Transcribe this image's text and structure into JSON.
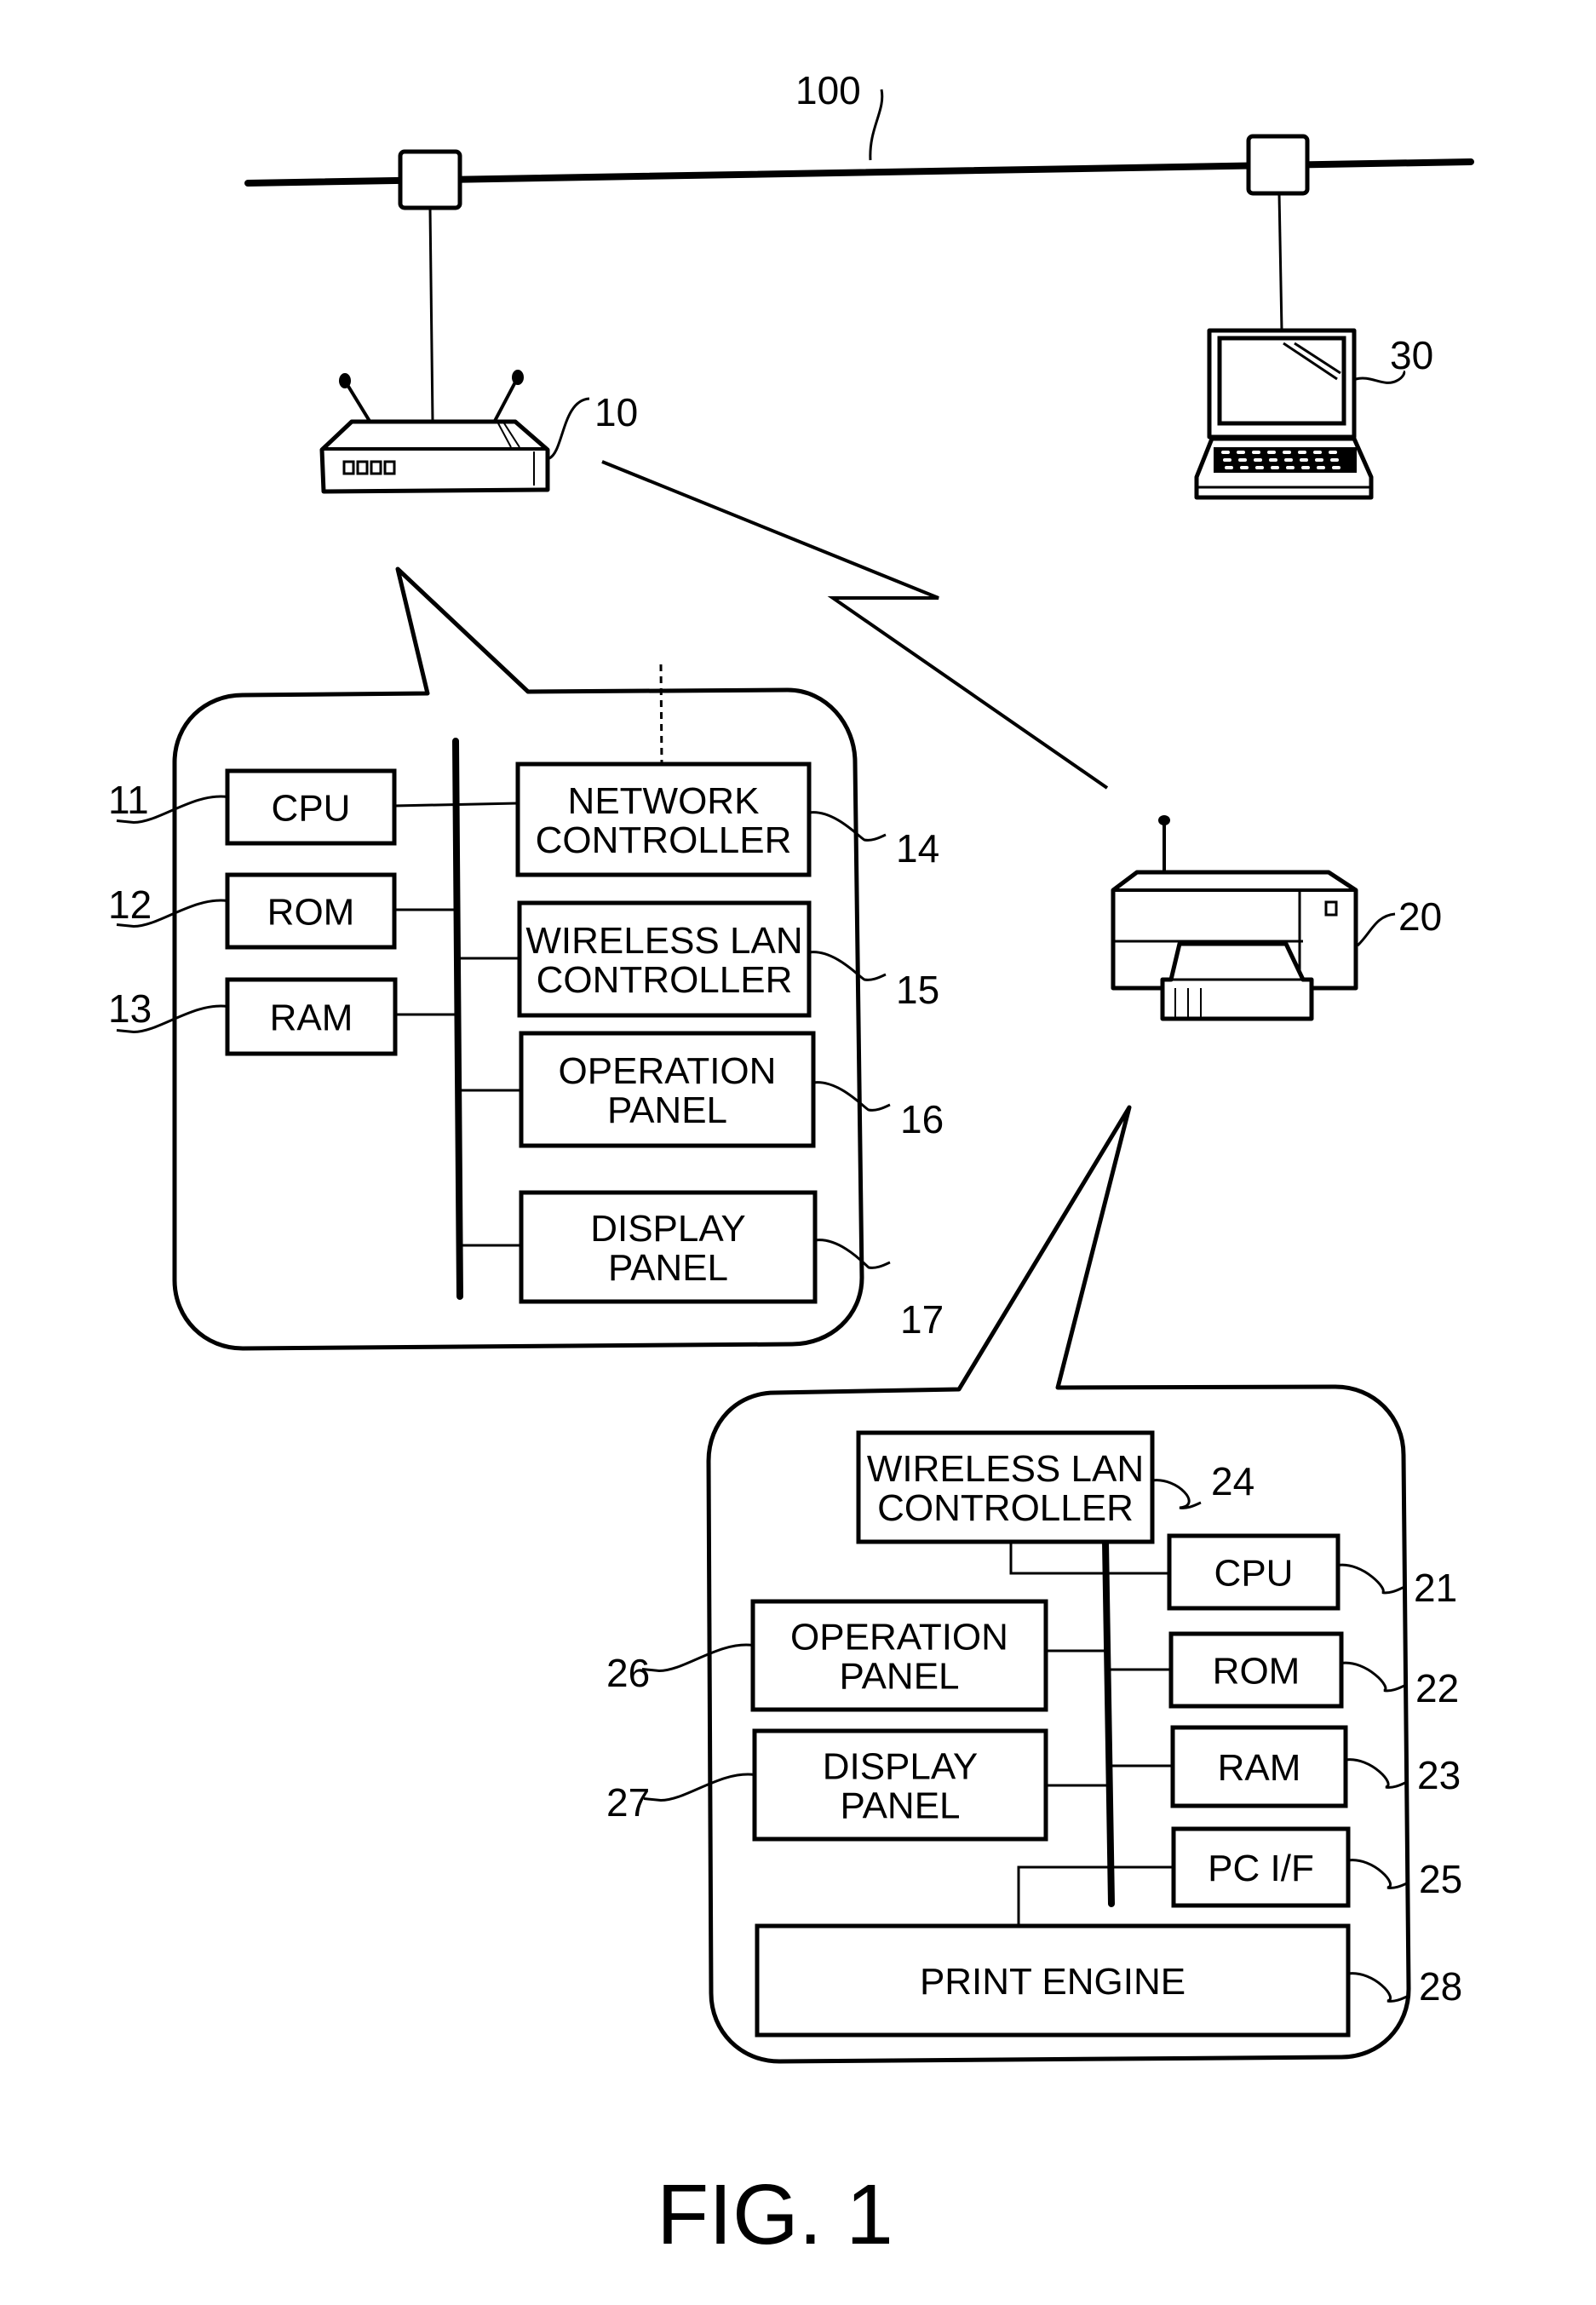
{
  "figure": {
    "caption": "FIG. 1",
    "network": {
      "ref": "100",
      "name": "network"
    },
    "devices": {
      "access_point": {
        "ref": "10",
        "name": "wireless access point"
      },
      "printer": {
        "ref": "20",
        "name": "printer"
      },
      "computer": {
        "ref": "30",
        "name": "personal computer"
      }
    },
    "access_point_blocks": [
      {
        "ref": "11",
        "lines": [
          "CPU"
        ]
      },
      {
        "ref": "12",
        "lines": [
          "ROM"
        ]
      },
      {
        "ref": "13",
        "lines": [
          "RAM"
        ]
      },
      {
        "ref": "14",
        "lines": [
          "NETWORK",
          "CONTROLLER"
        ]
      },
      {
        "ref": "15",
        "lines": [
          "WIRELESS LAN",
          "CONTROLLER"
        ]
      },
      {
        "ref": "16",
        "lines": [
          "OPERATION",
          "PANEL"
        ]
      },
      {
        "ref": "17",
        "lines": [
          "DISPLAY",
          "PANEL"
        ]
      }
    ],
    "printer_blocks": [
      {
        "ref": "21",
        "lines": [
          "CPU"
        ]
      },
      {
        "ref": "22",
        "lines": [
          "ROM"
        ]
      },
      {
        "ref": "23",
        "lines": [
          "RAM"
        ]
      },
      {
        "ref": "24",
        "lines": [
          "WIRELESS LAN",
          "CONTROLLER"
        ]
      },
      {
        "ref": "25",
        "lines": [
          "PC I/F"
        ]
      },
      {
        "ref": "26",
        "lines": [
          "OPERATION",
          "PANEL"
        ]
      },
      {
        "ref": "27",
        "lines": [
          "DISPLAY",
          "PANEL"
        ]
      },
      {
        "ref": "28",
        "lines": [
          "PRINT ENGINE"
        ]
      }
    ]
  },
  "colors": {
    "ink": "#000000",
    "paper": "#ffffff"
  }
}
